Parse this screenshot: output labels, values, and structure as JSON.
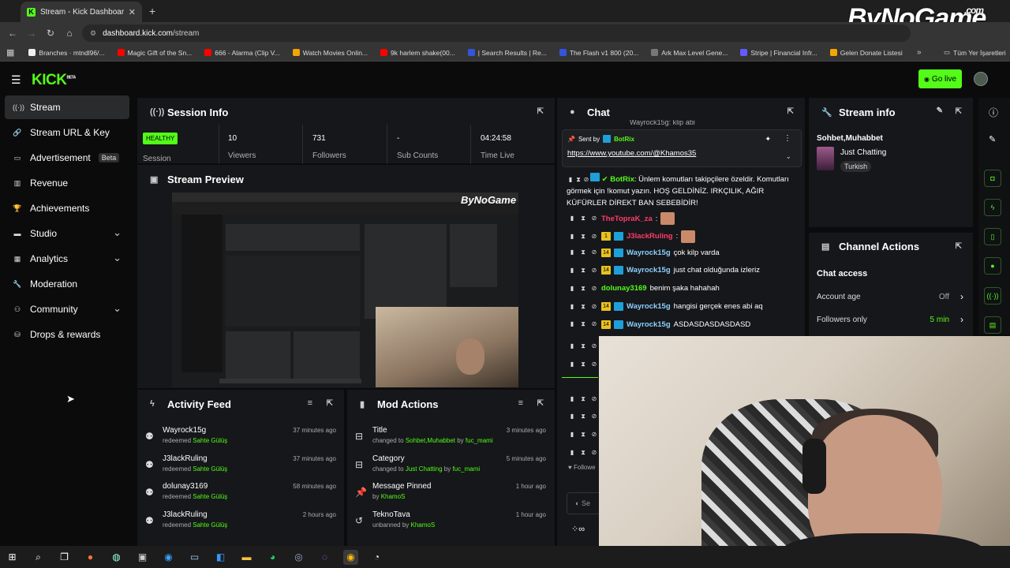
{
  "browser": {
    "tab_title": "Stream - Kick Dashboard",
    "tab_favicon": "K",
    "new_tab": "+",
    "url_host": "dashboard.kick.com",
    "url_path": "/stream",
    "bookmarks": [
      {
        "label": "Branches · mtndl96/...",
        "color": "#eeeeee"
      },
      {
        "label": "Magic Gift of the Sn...",
        "color": "#ff0000"
      },
      {
        "label": "666 - Alarma (Clip V...",
        "color": "#ff0000"
      },
      {
        "label": "Watch Movies Onlin...",
        "color": "#f2a600"
      },
      {
        "label": "9k harlem shake(00...",
        "color": "#ff0000"
      },
      {
        "label": "| Search Results | Re...",
        "color": "#3355dd"
      },
      {
        "label": "The Flash v1 800 (20...",
        "color": "#3355dd"
      },
      {
        "label": "Ark Max Level Gene...",
        "color": "#777777"
      },
      {
        "label": "Stripe | Financial Infr...",
        "color": "#635bff"
      },
      {
        "label": "Gelen Donate Listesi",
        "color": "#f2a600"
      }
    ],
    "all_bookmarks": "Tüm Yer İşaretleri"
  },
  "watermark": {
    "text": "ByNoGame",
    "suffix": ".com"
  },
  "header": {
    "logo": "KICK",
    "logo_sup": "BETA",
    "go_live": "Go live"
  },
  "sidebar": {
    "items": [
      {
        "label": "Stream",
        "icon": "broadcast-icon"
      },
      {
        "label": "Stream URL & Key",
        "icon": "link-icon"
      },
      {
        "label": "Advertisement",
        "icon": "ad-icon",
        "badge": "Beta"
      },
      {
        "label": "Revenue",
        "icon": "revenue-icon"
      },
      {
        "label": "Achievements",
        "icon": "trophy-icon"
      },
      {
        "label": "Studio",
        "icon": "studio-icon"
      },
      {
        "label": "Analytics",
        "icon": "analytics-icon"
      },
      {
        "label": "Moderation",
        "icon": "wrench-icon"
      },
      {
        "label": "Community",
        "icon": "community-icon"
      },
      {
        "label": "Drops & rewards",
        "icon": "gift-icon"
      }
    ]
  },
  "session": {
    "title": "Session Info",
    "health": "HEALTHY",
    "health_label": "Session",
    "stats": [
      {
        "value": "10",
        "label": "Viewers"
      },
      {
        "value": "731",
        "label": "Followers"
      },
      {
        "value": "-",
        "label": "Sub Counts"
      },
      {
        "value": "04:24:58",
        "label": "Time Live"
      }
    ]
  },
  "preview": {
    "title": "Stream Preview",
    "watermark": "ByNoGame"
  },
  "activity": {
    "title": "Activity Feed",
    "items": [
      {
        "user": "Wayrock15g",
        "action": "redeemed",
        "reward": "Sahte Gülüş",
        "time": "37 minutes ago"
      },
      {
        "user": "J3lackRuling",
        "action": "redeemed",
        "reward": "Sahte Gülüş",
        "time": "37 minutes ago"
      },
      {
        "user": "dolunay3169",
        "action": "redeemed",
        "reward": "Sahte Gülüş",
        "time": "58 minutes ago"
      },
      {
        "user": "J3lackRuling",
        "action": "redeemed",
        "reward": "Sahte Gülüş",
        "time": "2 hours ago"
      }
    ]
  },
  "mod": {
    "title": "Mod Actions",
    "items": [
      {
        "title": "Title",
        "pre": "changed to",
        "value": "Sohbet,Muhabbet",
        "by": "by",
        "actor": "fuc_mami",
        "time": "3 minutes ago"
      },
      {
        "title": "Category",
        "pre": "changed to",
        "value": "Just Chatting",
        "by": "by",
        "actor": "fuc_mami",
        "time": "5 minutes ago"
      },
      {
        "title": "Message Pinned",
        "pre": "by",
        "value": "",
        "by": "",
        "actor": "KhamoS",
        "time": "1 hour ago"
      },
      {
        "title": "TeknoTava",
        "pre": "unbanned by",
        "value": "",
        "by": "",
        "actor": "KhamoS",
        "time": "1 hour ago"
      }
    ]
  },
  "chat": {
    "title": "Chat",
    "pinned": {
      "sent_by": "Sent by",
      "user": "BotRix",
      "link": "https://www.youtube.com/@Khamos35"
    },
    "bot_message": {
      "user": "BotRix",
      "text": "Ünlem komutları takipçilere özeldir. Komutları görmek için !komut yazın. HOŞ GELDİNİZ. IRKÇILIK, AĞIR KÜFÜRLER DİREKT BAN SEBEBİDİR!"
    },
    "messages": [
      {
        "user": "TheTopraK_za",
        "text": ":",
        "color": "#ff3b6b",
        "badge": ""
      },
      {
        "user": "J3lackRuling",
        "text": ":",
        "color": "#ff3b6b",
        "badge": "1"
      },
      {
        "user": "Wayrock15g",
        "text": "çok kilp varda",
        "color": "#8bd0ff",
        "badge": "14"
      },
      {
        "user": "Wayrock15g",
        "text": "just chat olduğunda izleriz",
        "color": "#8bd0ff",
        "badge": "14"
      },
      {
        "user": "dolunay3169",
        "text": "benim şaka hahahah",
        "color": "#53fc18",
        "badge": ""
      },
      {
        "user": "Wayrock15g",
        "text": "hangisi gerçek enes abi aq",
        "color": "#8bd0ff",
        "badge": "14"
      },
      {
        "user": "Wayrock15g",
        "text": "ASDASDASDASDASD",
        "color": "#8bd0ff",
        "badge": "14"
      }
    ],
    "top_partial": "Wayrock15g: klip abi",
    "followers_partial": "Followe",
    "input_partial": "Se"
  },
  "stream_info": {
    "title": "Stream info",
    "stream_title": "Sohbet,Muhabbet",
    "category": "Just Chatting",
    "tag": "Turkish"
  },
  "channel_actions": {
    "title": "Channel Actions",
    "section": "Chat access",
    "rows": [
      {
        "label": "Account age",
        "value": "Off"
      },
      {
        "label": "Followers only",
        "value": "5 min"
      }
    ]
  },
  "colors": {
    "accent": "#53fc18",
    "panel": "#16171a",
    "bg": "#0b0b0c"
  }
}
